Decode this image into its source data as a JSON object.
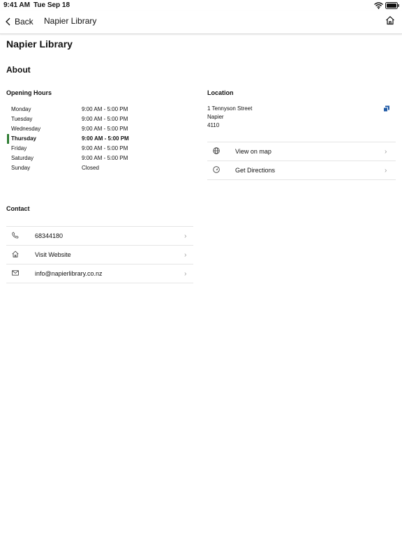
{
  "status_bar": {
    "time": "9:41 AM",
    "date": "Tue Sep 18"
  },
  "nav": {
    "back_label": "Back",
    "title": "Napier Library"
  },
  "page": {
    "title": "Napier Library",
    "about_heading": "About"
  },
  "opening_hours": {
    "heading": "Opening Hours",
    "rows": [
      {
        "day": "Monday",
        "hours": "9:00 AM - 5:00 PM"
      },
      {
        "day": "Tuesday",
        "hours": "9:00 AM - 5:00 PM"
      },
      {
        "day": "Wednesday",
        "hours": "9:00 AM - 5:00 PM"
      },
      {
        "day": "Thursday",
        "hours": "9:00 AM - 5:00 PM"
      },
      {
        "day": "Friday",
        "hours": "9:00 AM - 5:00 PM"
      },
      {
        "day": "Saturday",
        "hours": "9:00 AM - 5:00 PM"
      },
      {
        "day": "Sunday",
        "hours": "Closed"
      }
    ],
    "highlight_color": "#2e7d32"
  },
  "location": {
    "heading": "Location",
    "address": [
      "1 Tennyson Street",
      "Napier",
      "4110"
    ],
    "actions": [
      {
        "label": "View on map",
        "icon": "globe-icon"
      },
      {
        "label": "Get Directions",
        "icon": "directions-icon"
      }
    ],
    "copy_icon_color": "#1f5aa6"
  },
  "contact": {
    "heading": "Contact",
    "items": [
      {
        "label": "68344180",
        "icon": "phone-icon"
      },
      {
        "label": "Visit Website",
        "icon": "home-icon"
      },
      {
        "label": "info@napierlibrary.co.nz",
        "icon": "mail-icon"
      }
    ]
  }
}
